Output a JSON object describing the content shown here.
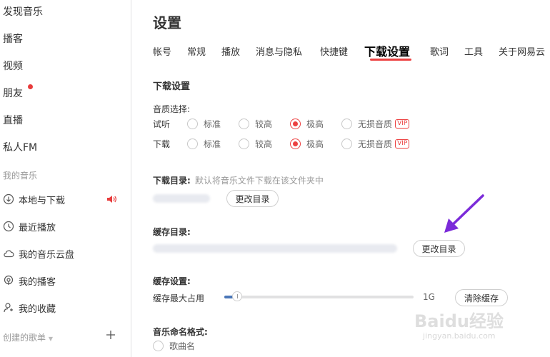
{
  "sidebar": {
    "nav": [
      {
        "label": "发现音乐"
      },
      {
        "label": "播客"
      },
      {
        "label": "视频"
      },
      {
        "label": "朋友"
      },
      {
        "label": "直播"
      },
      {
        "label": "私人FM"
      }
    ],
    "my_music_label": "我的音乐",
    "my_music": [
      {
        "label": "本地与下载",
        "icon": "download-circle-icon"
      },
      {
        "label": "最近播放",
        "icon": "recent-clock-icon"
      },
      {
        "label": "我的音乐云盘",
        "icon": "cloud-icon"
      },
      {
        "label": "我的播客",
        "icon": "podcast-icon"
      },
      {
        "label": "我的收藏",
        "icon": "collection-icon"
      }
    ],
    "created_playlists_label": "创建的歌单"
  },
  "main": {
    "title": "设置",
    "tabs": [
      {
        "label": "帐号"
      },
      {
        "label": "常规"
      },
      {
        "label": "播放"
      },
      {
        "label": "消息与隐私"
      },
      {
        "label": "快捷键"
      },
      {
        "label": "下载设置",
        "active": true
      },
      {
        "label": "歌词"
      },
      {
        "label": "工具"
      },
      {
        "label": "关于网易云"
      }
    ],
    "download": {
      "section_title": "下载设置",
      "quality_label": "音质选择:",
      "rows": [
        {
          "label": "试听",
          "options": [
            "标准",
            "较高",
            "极高",
            "无损音质"
          ],
          "selected": "极高"
        },
        {
          "label": "下载",
          "options": [
            "标准",
            "较高",
            "极高",
            "无损音质"
          ],
          "selected": "极高"
        }
      ],
      "vip": "VIP",
      "dir_label": "下载目录:",
      "dir_hint": "默认将音乐文件下载在该文件夹中",
      "change_dir": "更改目录"
    },
    "cache": {
      "dir_label": "缓存目录:",
      "change_dir": "更改目录",
      "settings_label": "缓存设置:",
      "max_label": "缓存最大占用",
      "max_value": "1G",
      "slider_fraction": 0.05,
      "clear": "清除缓存"
    },
    "naming": {
      "label": "音乐命名格式:",
      "option1": "歌曲名"
    }
  },
  "watermark": {
    "text": "Baidu经验",
    "sub": "jingyan.baidu.com"
  },
  "colors": {
    "accent": "#ec4141",
    "slider": "#4b77b8",
    "annotation_arrow": "#7b2bd9"
  }
}
